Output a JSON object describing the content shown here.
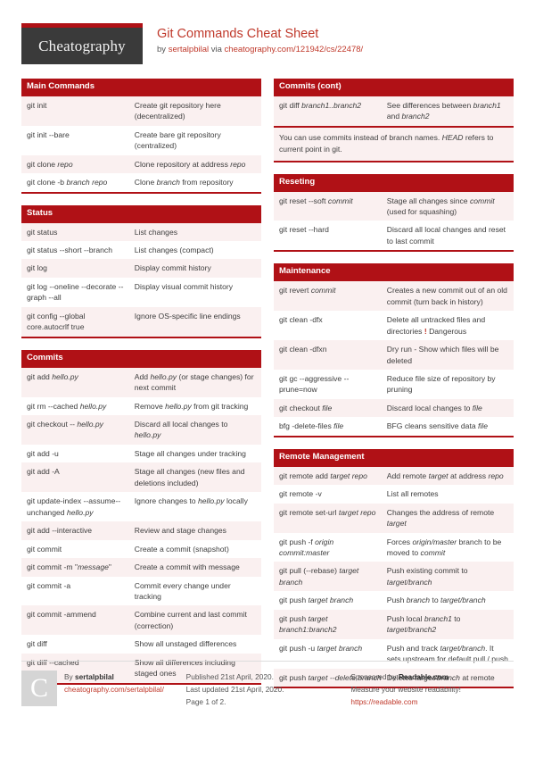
{
  "header": {
    "logo_text": "Cheatography",
    "title": "Git Commands Cheat Sheet",
    "byline_prefix": "by ",
    "author": "sertalpbilal",
    "byline_mid": " via ",
    "source": "cheatography.com/121942/cs/22478/"
  },
  "colors": {
    "accent": "#b01116",
    "link": "#c0392b",
    "row_alt": "#faf0f0",
    "logo_bg": "#3a3a3a"
  },
  "left_column": [
    {
      "title": "Main Commands",
      "rows": [
        {
          "cmd": "git init",
          "desc": "Create git repository here (decentralized)"
        },
        {
          "cmd": "git init --bare",
          "desc": "Create bare git repository (centralized)"
        },
        {
          "cmd": "git clone <em>repo</em>",
          "desc": "Clone repository at address <em>repo</em>"
        },
        {
          "cmd": "git clone -b <em>branch repo</em>",
          "desc": "Clone <em>branch</em> from repository"
        }
      ]
    },
    {
      "title": "Status",
      "rows": [
        {
          "cmd": "git status",
          "desc": "List changes"
        },
        {
          "cmd": "git status --short --branch",
          "desc": "List changes (compact)"
        },
        {
          "cmd": "git log",
          "desc": "Display commit history"
        },
        {
          "cmd": "git log --oneline --decorate --graph -⁠-all",
          "desc": "Display visual commit history"
        },
        {
          "cmd": "git config --global core.autocrlf true",
          "desc": "Ignore OS-specific line endings"
        }
      ]
    },
    {
      "title": "Commits",
      "rows": [
        {
          "cmd": "git add <em>hello.py</em>",
          "desc": "Add <em>hello.py</em> (or stage changes) for next commit"
        },
        {
          "cmd": "git rm --cached <em>hello.py</em>",
          "desc": "Remove <em>hello.py</em> from git tracking"
        },
        {
          "cmd": "git checkout -- <em>hello.py</em>",
          "desc": "Discard all local changes to <em>hello.py</em>"
        },
        {
          "cmd": "git add -u",
          "desc": "Stage all changes under tracking"
        },
        {
          "cmd": "git add -A",
          "desc": "Stage all changes (new files and deletions included)"
        },
        {
          "cmd": "git update-index --assume--unchanged <em>hello.py</em>",
          "desc": "Ignore changes to <em>hello.py</em> locally"
        },
        {
          "cmd": "git add --interactive",
          "desc": "Review and stage changes"
        },
        {
          "cmd": "git commit",
          "desc": "Create a commit (snapshot)"
        },
        {
          "cmd": "git commit -m \"<em>message</em>\"",
          "desc": "Create a commit with message"
        },
        {
          "cmd": "git commit -a",
          "desc": "Commit every change under tracking"
        },
        {
          "cmd": "git commit -ammend",
          "desc": "Combine current and last commit (correction)"
        },
        {
          "cmd": "git diff",
          "desc": "Show all unstaged differences"
        },
        {
          "cmd": "git diff --cached",
          "desc": "Show all differences including staged ones"
        }
      ]
    }
  ],
  "right_column": [
    {
      "title": "Commits (cont)",
      "rows": [
        {
          "cmd": "git diff <em>branch1..bra⁠nch2</em>",
          "desc": "See differences between <em>branch1</em> and <em>branch2</em>"
        }
      ],
      "note": "You can use commits instead of branch names. <em>HEAD</em> refers to current point in git."
    },
    {
      "title": "Reseting",
      "rows": [
        {
          "cmd": "git reset --soft <em>commit</em>",
          "desc": "Stage all changes since <em>commit</em> (used for squashing)"
        },
        {
          "cmd": "git reset --hard",
          "desc": "Discard all local changes and reset to last commit"
        }
      ]
    },
    {
      "title": "Maintenance",
      "rows": [
        {
          "cmd": "git revert <em>commit</em>",
          "desc": "Creates a new commit out of an old commit (turn back in history)"
        },
        {
          "cmd": "git clean -dfx",
          "desc": "Delete all untracked files and directories <span class=\"danger\">!</span> Dangerous"
        },
        {
          "cmd": "git clean -dfxn",
          "desc": "Dry run - Show which files will be deleted"
        },
        {
          "cmd": "git gc --aggressive --prune=now",
          "desc": "Reduce file size of repository by pruning"
        },
        {
          "cmd": "git checkout <em>file</em>",
          "desc": "Discard local changes to <em>file</em>"
        },
        {
          "cmd": "bfg -delete-files <em>file</em>",
          "desc": "BFG cleans sensitive data <em>file</em>"
        }
      ]
    },
    {
      "title": "Remote Management",
      "rows": [
        {
          "cmd": "git remote add <em>target repo</em>",
          "desc": "Add remote <em>target</em> at address <em>repo</em>"
        },
        {
          "cmd": "git remote -v",
          "desc": "List all remotes"
        },
        {
          "cmd": "git remote set-url <em>target repo</em>",
          "desc": "Changes the address of remote <em>target</em>"
        },
        {
          "cmd": "git push -f <em>origin commit:master</em>",
          "desc": "Forces <em>origin/master</em> branch to be moved to <em>commit</em>"
        },
        {
          "cmd": "git pull (--rebase) <em>target branch</em>",
          "desc": "Push existing commit to <em>target/branch</em>"
        },
        {
          "cmd": "git push <em>target branch</em>",
          "desc": "Push <em>branch</em> to <em>target/branch</em>"
        },
        {
          "cmd": "git push <em>target branch1:branch2</em>",
          "desc": "Push local <em>branch1</em> to <em>target/branch2</em>"
        },
        {
          "cmd": "git push -u <em>target branch</em>",
          "desc": "Push and track <em>target/branch</em>. It sets upstream for default pull / push"
        },
        {
          "cmd": "git push <em>target --delete branch</em>",
          "desc": "Deletes <em>target/branch</em> at remote"
        }
      ]
    }
  ],
  "footer": {
    "avatar_letter": "C",
    "by_label": "By ",
    "author": "sertalpbilal",
    "author_url": "cheatography.com/sertalpbilal/",
    "published": "Published 21st April, 2020.",
    "updated": "Last updated 21st April, 2020.",
    "page": "Page 1 of 2.",
    "sponsor_prefix": "Sponsored by ",
    "sponsor_name": "Readable.com",
    "sponsor_tagline": "Measure your website readability!",
    "sponsor_url": "https://readable.com"
  }
}
